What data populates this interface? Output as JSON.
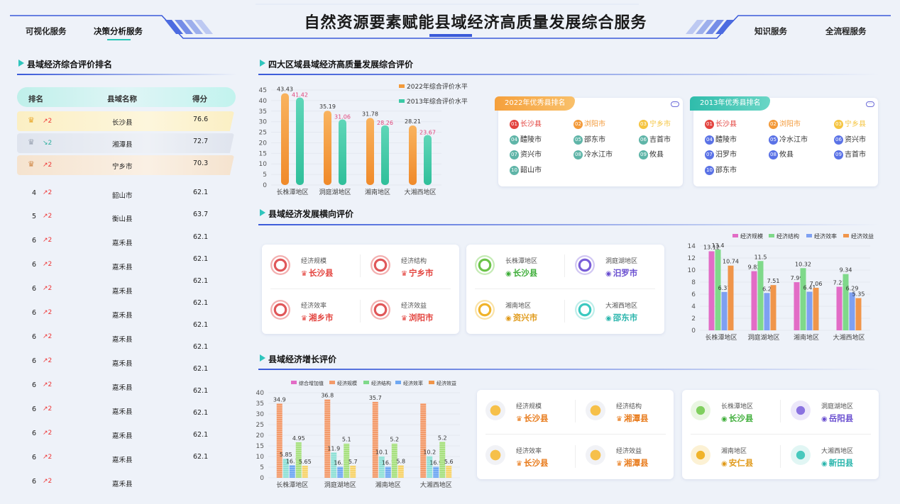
{
  "header": {
    "title": "自然资源要素赋能县域经济高质量发展综合服务",
    "nav_left": [
      "可视化服务",
      "决策分析服务"
    ],
    "nav_right": [
      "知识服务",
      "全流程服务"
    ]
  },
  "ranking": {
    "title": "县域经济综合评价排名",
    "columns": [
      "排名",
      "县域名称",
      "得分"
    ],
    "rows": [
      {
        "rank": "",
        "change": "2",
        "dir": "up",
        "name": "长沙县",
        "score": "76.6"
      },
      {
        "rank": "",
        "change": "2",
        "dir": "down",
        "name": "湘潭县",
        "score": "72.7"
      },
      {
        "rank": "",
        "change": "2",
        "dir": "up",
        "name": "宁乡市",
        "score": "70.3"
      },
      {
        "rank": "4",
        "change": "2",
        "dir": "up",
        "name": "韶山市",
        "score": "62.1"
      },
      {
        "rank": "5",
        "change": "2",
        "dir": "up",
        "name": "衡山县",
        "score": "63.7"
      },
      {
        "rank": "6",
        "change": "2",
        "dir": "up",
        "name": "嘉禾县",
        "score": "62.1"
      },
      {
        "rank": "6",
        "change": "2",
        "dir": "up",
        "name": "嘉禾县",
        "score": "62.1"
      },
      {
        "rank": "6",
        "change": "2",
        "dir": "up",
        "name": "嘉禾县",
        "score": "62.1"
      },
      {
        "rank": "6",
        "change": "2",
        "dir": "up",
        "name": "嘉禾县",
        "score": "62.1"
      },
      {
        "rank": "6",
        "change": "2",
        "dir": "up",
        "name": "嘉禾县",
        "score": "62.1"
      },
      {
        "rank": "6",
        "change": "2",
        "dir": "up",
        "name": "嘉禾县",
        "score": "62.1"
      },
      {
        "rank": "6",
        "change": "2",
        "dir": "up",
        "name": "嘉禾县",
        "score": "62.1"
      },
      {
        "rank": "6",
        "change": "2",
        "dir": "up",
        "name": "嘉禾县",
        "score": "62.1"
      },
      {
        "rank": "6",
        "change": "2",
        "dir": "up",
        "name": "嘉禾县",
        "score": "62.1"
      },
      {
        "rank": "6",
        "change": "2",
        "dir": "up",
        "name": "嘉禾县",
        "score": "62.1"
      },
      {
        "rank": "6",
        "change": "2",
        "dir": "up",
        "name": "嘉禾县",
        "score": "62.1"
      }
    ]
  },
  "sec1": {
    "title": "四大区域县域经济高质量发展综合评价"
  },
  "sec2": {
    "title": "县域经济发展横向评价"
  },
  "sec3": {
    "title": "县域经济增长评价"
  },
  "excellent": {
    "y2022": {
      "label": "2022年优秀县排名",
      "items": [
        "长沙县",
        "浏阳市",
        "宁乡市",
        "醴陵市",
        "邵东市",
        "吉首市",
        "资兴市",
        "冷水江市",
        "攸县",
        "韶山市"
      ]
    },
    "y2013": {
      "label": "2013年优秀县排名",
      "items": [
        "长沙县",
        "浏阳市",
        "宁乡县",
        "醴陵市",
        "冷水江市",
        "资兴市",
        "汨罗市",
        "攸县",
        "吉首市",
        "邵东市"
      ]
    }
  },
  "h_eval1": [
    {
      "label": "经济规模",
      "value": "长沙县"
    },
    {
      "label": "经济结构",
      "value": "宁乡市"
    },
    {
      "label": "经济效率",
      "value": "湘乡市"
    },
    {
      "label": "经济效益",
      "value": "浏阳市"
    }
  ],
  "h_eval2": [
    {
      "label": "长株潭地区",
      "value": "长沙县"
    },
    {
      "label": "洞庭湖地区",
      "value": "汨罗市"
    },
    {
      "label": "湘南地区",
      "value": "资兴市"
    },
    {
      "label": "大湘西地区",
      "value": "邵东市"
    }
  ],
  "g_eval1": [
    {
      "label": "经济规模",
      "value": "长沙县"
    },
    {
      "label": "经济结构",
      "value": "湘潭县"
    },
    {
      "label": "经济效率",
      "value": "长沙县"
    },
    {
      "label": "经济效益",
      "value": "湘潭县"
    }
  ],
  "g_eval2": [
    {
      "label": "长株潭地区",
      "value": "长沙县"
    },
    {
      "label": "洞庭湖地区",
      "value": "岳阳县"
    },
    {
      "label": "湘南地区",
      "value": "安仁县"
    },
    {
      "label": "大湘西地区",
      "value": "新田县"
    }
  ],
  "colors": {
    "accent": "#3a5ad9",
    "teal": "#2fc5bd",
    "orange": "#f39a3a",
    "green": "#3cc9a6",
    "red": "#e3443f"
  },
  "chart_data": [
    {
      "type": "bar",
      "categories": [
        "长株潭地区",
        "洞庭湖地区",
        "湘南地区",
        "大湘西地区"
      ],
      "series": [
        {
          "name": "2022年综合评价水平",
          "values": [
            43.43,
            35.19,
            31.78,
            28.21
          ]
        },
        {
          "name": "2013年综合评价水平",
          "values": [
            41.42,
            31.06,
            28.26,
            23.67
          ]
        }
      ],
      "ylim": [
        0,
        45
      ],
      "yticks": [
        0,
        5,
        10,
        15,
        20,
        25,
        30,
        35,
        40,
        45
      ],
      "legend": "top-right"
    },
    {
      "type": "bar",
      "categories": [
        "长株潭地区",
        "洞庭湖地区",
        "湘南地区",
        "大湘西地区"
      ],
      "series": [
        {
          "name": "经济规模",
          "values": [
            13.12,
            9.82,
            7.99,
            7.23
          ]
        },
        {
          "name": "经济结构",
          "values": [
            13.4,
            11.5,
            10.32,
            9.34
          ]
        },
        {
          "name": "经济效率",
          "values": [
            6.37,
            6.2,
            6.41,
            6.29
          ]
        },
        {
          "name": "经济效益",
          "values": [
            10.74,
            7.51,
            7.06,
            5.35
          ]
        }
      ],
      "ylim": [
        0,
        14
      ],
      "yticks": [
        0,
        2,
        4,
        6,
        8,
        10,
        12,
        14
      ],
      "legend": "top"
    },
    {
      "type": "bar",
      "categories": [
        "长株潭地区",
        "洞庭湖地区",
        "湘南地区",
        "大湘西地区"
      ],
      "series": [
        {
          "name": "综合增加值",
          "values": [
            34.9,
            36.8,
            35.7,
            35
          ]
        },
        {
          "name": "经济规模",
          "values": [
            9,
            11.9,
            10.1,
            10.2
          ]
        },
        {
          "name": "经济结构",
          "values": [
            5.85,
            5.2,
            5.2,
            5.2
          ]
        },
        {
          "name": "经济效率",
          "values": [
            16.7,
            16.1,
            16.1,
            16.9
          ]
        },
        {
          "name": "经济效益",
          "values": [
            5.65,
            5.7,
            5.8,
            5.6
          ]
        }
      ],
      "labels": [
        [
          "34.9",
          "5.85",
          "16.7",
          "4.95",
          "5.65"
        ],
        [
          "36.8",
          "11.9",
          "16.1",
          "5.1",
          "5.7"
        ],
        [
          "35.7",
          "10.1",
          "16.1",
          "5.2",
          "5.8"
        ],
        [
          "",
          "10.2",
          "16.9",
          "5.2",
          "5.6"
        ]
      ],
      "ylim": [
        0,
        40
      ],
      "yticks": [
        0,
        5,
        10,
        15,
        20,
        25,
        30,
        35,
        40
      ],
      "legend": "top"
    }
  ]
}
